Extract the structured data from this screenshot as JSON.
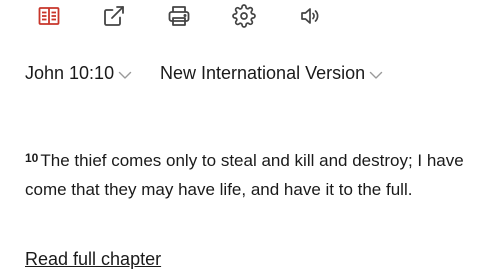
{
  "toolbar": {
    "icons": [
      "parallel-bible-icon",
      "share-external-icon",
      "print-icon",
      "settings-gear-icon",
      "audio-speaker-icon"
    ],
    "active_color": "#c8352a",
    "icon_color": "#444444"
  },
  "reference": {
    "label": "John 10:10"
  },
  "version": {
    "label": "New International Version"
  },
  "verse": {
    "number": "10",
    "text": "The thief comes only to steal and kill and destroy; I have come that they may have life, and have it to the full."
  },
  "links": {
    "read_full_chapter": "Read full chapter"
  }
}
